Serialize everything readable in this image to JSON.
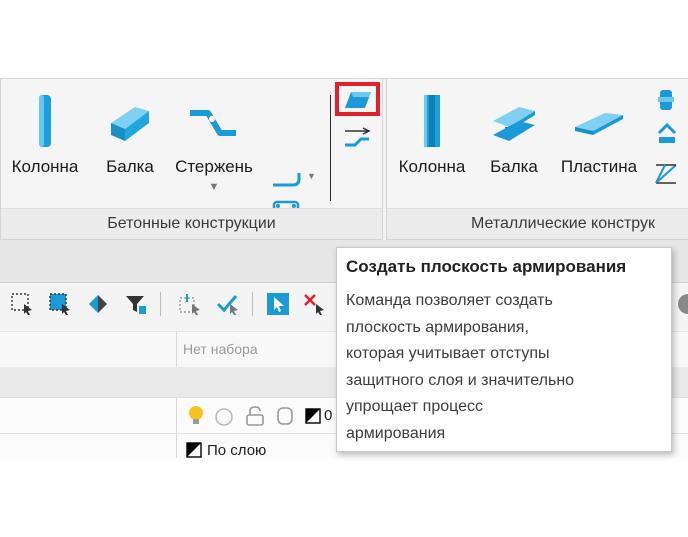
{
  "ribbon": {
    "concrete_panel": {
      "title": "Бетонные конструкции",
      "buttons": [
        "Колонна",
        "Балка",
        "Стержень"
      ]
    },
    "metal_panel": {
      "title": "Металлические конструк",
      "buttons": [
        "Колонна",
        "Балка",
        "Пластина"
      ]
    },
    "highlight_color": "#e0202a",
    "icon_color": "#1a9ad6"
  },
  "properties": {
    "set_placeholder": "Нет набора",
    "layer_value": "По слою",
    "layer_number": "0"
  },
  "tooltip": {
    "title": "Создать плоскость армирования",
    "lines": [
      "Команда позволяет создать",
      "плоскость армирования,",
      "которая учитывает отступы",
      "защитного слоя и значительно",
      "упрощает процесс",
      "армирования"
    ]
  }
}
